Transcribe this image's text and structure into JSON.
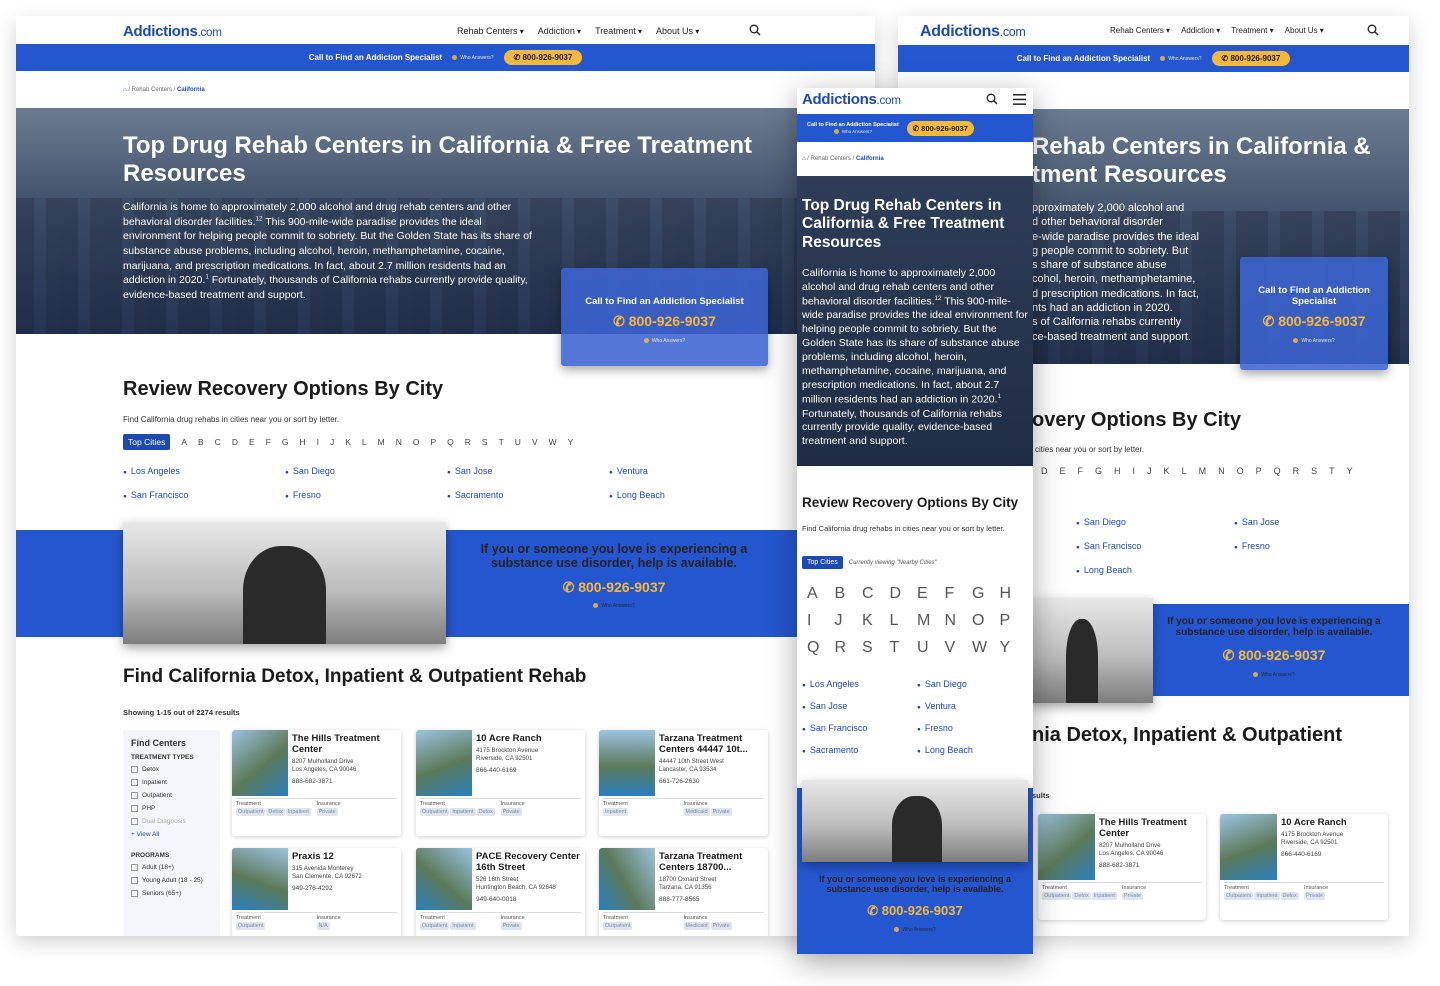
{
  "logo": {
    "name": "Addictions",
    "tld": ".com"
  },
  "nav": [
    "Rehab Centers",
    "Addiction",
    "Treatment",
    "About Us"
  ],
  "callbar": {
    "text": "Call to Find an Addiction Specialist",
    "who": "Who Answers?",
    "phone": "800-926-9037"
  },
  "breadcrumb": {
    "items": [
      "Rehab Centers",
      "California"
    ]
  },
  "hero": {
    "title": "Top Drug Rehab Centers in California & Free Treatment Resources",
    "title_right": "Rehab Centers in California & tment Resources",
    "body_1": "California is home to approximately 2,000 alcohol and drug rehab centers and other behavioral disorder facilities.",
    "sup_1": "12",
    "body_2": " This 900-mile-wide paradise provides the ideal environment for helping people commit to sobriety. But the Golden State has its share of substance abuse problems, including alcohol, heroin, methamphetamine, cocaine, marijuana, and prescription medications. In fact, about 2.7 million residents had an addiction in 2020.",
    "sup_2": "1",
    "body_3": " Fortunately, thousands of California rehabs currently provide quality, evidence-based treatment and support.",
    "right_lines": [
      "pproximately 2,000 alcohol and",
      "d other behavioral disorder",
      "e-wide paradise provides the ideal",
      "g people commit to sobriety. But",
      "s share of substance abuse",
      "cohol, heroin, methamphetamine,",
      "d prescription medications. In fact,",
      "nts had an addiction in 2020.",
      "s of California rehabs currently",
      "ce-based treatment and support."
    ]
  },
  "cta": {
    "title": "Call to Find an Addiction Specialist",
    "phone": "800-926-9037",
    "who": "Who Answers?"
  },
  "review": {
    "title": "Review Recovery Options By City",
    "title_right": "overy Options By City",
    "sub": "Find California drug rehabs in cities near you or sort by letter.",
    "sub_right": "cities near you or sort by letter.",
    "top_cities": "Top Cities",
    "viewing": "Currently viewing \"Nearby Cities\"",
    "letters": [
      "A",
      "B",
      "C",
      "D",
      "E",
      "F",
      "G",
      "H",
      "I",
      "J",
      "K",
      "L",
      "M",
      "N",
      "O",
      "P",
      "Q",
      "R",
      "S",
      "T",
      "U",
      "V",
      "W",
      "Y"
    ],
    "letters_right": [
      "D",
      "E",
      "F",
      "G",
      "H",
      "I",
      "J",
      "K",
      "L",
      "M",
      "N",
      "O",
      "P",
      "Q",
      "R",
      "S",
      "T",
      "Y"
    ],
    "cities": [
      "Los Angeles",
      "San Diego",
      "San Jose",
      "Ventura",
      "San Francisco",
      "Fresno",
      "Sacramento",
      "Long Beach"
    ],
    "cities_right": [
      "San Diego",
      "San Jose",
      "San Francisco",
      "Fresno",
      "Long Beach"
    ]
  },
  "help": {
    "text": "If you or someone you love is experiencing a substance use disorder, help is available.",
    "phone": "800-926-9037",
    "who": "Who Answers?"
  },
  "find": {
    "title": "Find California Detox, Inpatient & Outpatient Rehab",
    "title_right": "nia Detox, Inpatient & Outpatient",
    "showing": "Showing 1-15 out of 2274 results",
    "showing_right": "sults"
  },
  "filters": {
    "title": "Find Centers",
    "types_label": "TREATMENT TYPES",
    "types": [
      "Detox",
      "Inpatient",
      "Outpatient",
      "PHP",
      "Dual Diagnosis"
    ],
    "view_all": "+ View All",
    "programs_label": "PROGRAMS",
    "programs": [
      "Adult (18+)",
      "Young Adult (18 - 25)",
      "Seniors (65+)"
    ]
  },
  "labels": {
    "treatment": "Treatment",
    "insurance": "Insurance"
  },
  "cards": [
    {
      "name": "The Hills Treatment Center",
      "addr1": "8207 Mulholland Drive",
      "addr2": "Los Angeles, CA 90046",
      "phone": "888-682-3871",
      "treatment": [
        "Outpatient",
        "Detox",
        "Inpatient"
      ],
      "insurance": [
        "Private"
      ]
    },
    {
      "name": "10 Acre Ranch",
      "addr1": "4175 Brockton Avenue",
      "addr2": "Riverside, CA 92501",
      "phone": "866-440-6169",
      "treatment": [
        "Outpatient",
        "Inpatient",
        "Detox"
      ],
      "insurance": [
        "Private"
      ]
    },
    {
      "name": "Tarzana Treatment Centers 44447 10t...",
      "addr1": "44447 10th Street West",
      "addr2": "Lancaster, CA 93534",
      "phone": "661-726-2630",
      "treatment": [
        "Inpatient"
      ],
      "insurance": [
        "Medicaid",
        "Private"
      ]
    },
    {
      "name": "Praxis 12",
      "addr1": "315 Avenida Monterey",
      "addr2": "San Clemente, CA 92672",
      "phone": "949-276-4292",
      "treatment": [
        "Outpatient"
      ],
      "insurance": [
        "N/A"
      ]
    },
    {
      "name": "PACE Recovery Center 16th Street",
      "addr1": "526 16th Street",
      "addr2": "Huntington Beach, CA 92648",
      "phone": "949-640-0018",
      "treatment": [
        "Outpatient",
        "Inpatient"
      ],
      "insurance": [
        "Private"
      ]
    },
    {
      "name": "Tarzana Treatment Centers 18700...",
      "addr1": "18700 Oxnard Street",
      "addr2": "Tarzana, CA 91356",
      "phone": "888-777-8565",
      "treatment": [
        "Outpatient"
      ],
      "insurance": [
        "Medicaid",
        "Private"
      ]
    }
  ],
  "colors": {
    "brand": "#2457cf",
    "accent": "#f6b93b",
    "link": "#1d49b3"
  },
  "icons": [
    "search-icon",
    "menu-icon",
    "home-icon",
    "phone-icon",
    "pin-icon"
  ]
}
